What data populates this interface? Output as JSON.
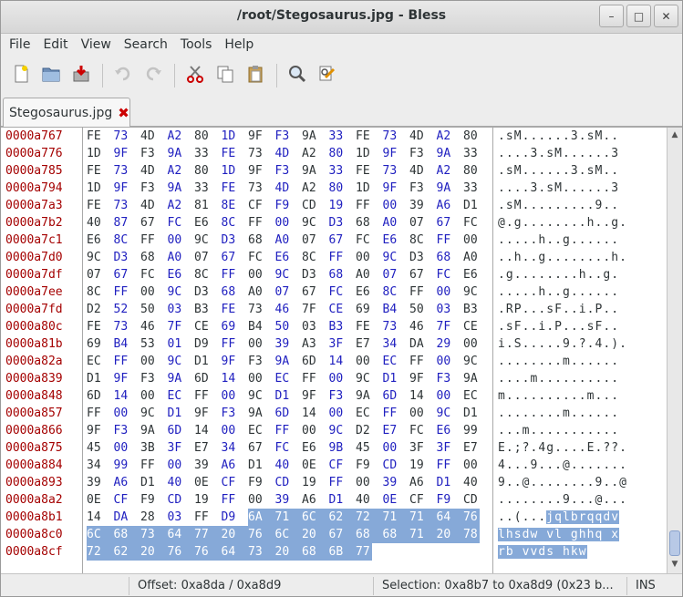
{
  "window": {
    "title": "/root/Stegosaurus.jpg - Bless"
  },
  "window_controls": {
    "minimize": "–",
    "maximize": "□",
    "close": "✕"
  },
  "menu": [
    "File",
    "Edit",
    "View",
    "Search",
    "Tools",
    "Help"
  ],
  "toolbar": [
    {
      "name": "new-file",
      "icon": "new-document-icon"
    },
    {
      "name": "open-file",
      "icon": "folder-open-icon"
    },
    {
      "name": "save-file",
      "icon": "save-icon"
    },
    {
      "sep": true
    },
    {
      "name": "undo",
      "icon": "undo-icon"
    },
    {
      "name": "redo",
      "icon": "redo-icon"
    },
    {
      "sep": true
    },
    {
      "name": "cut",
      "icon": "scissors-icon"
    },
    {
      "name": "copy",
      "icon": "copy-icon"
    },
    {
      "name": "paste",
      "icon": "clipboard-icon"
    },
    {
      "sep": true
    },
    {
      "name": "find",
      "icon": "magnifier-icon"
    },
    {
      "name": "find-replace",
      "icon": "find-replace-icon"
    }
  ],
  "tab": {
    "label": "Stegosaurus.jpg",
    "close": "✖"
  },
  "colors": {
    "offset": "#a40000",
    "byte_alt": "#2020c0",
    "selection": "#86a9d8"
  },
  "hex": {
    "offsets": [
      "0000a767",
      "0000a776",
      "0000a785",
      "0000a794",
      "0000a7a3",
      "0000a7b2",
      "0000a7c1",
      "0000a7d0",
      "0000a7df",
      "0000a7ee",
      "0000a7fd",
      "0000a80c",
      "0000a81b",
      "0000a82a",
      "0000a839",
      "0000a848",
      "0000a857",
      "0000a866",
      "0000a875",
      "0000a884",
      "0000a893",
      "0000a8a2",
      "0000a8b1",
      "0000a8c0",
      "0000a8cf"
    ],
    "rows": [
      "FE 73 4D A2 80 1D 9F F3 9A 33 FE 73 4D A2 80",
      "1D 9F F3 9A 33 FE 73 4D A2 80 1D 9F F3 9A 33",
      "FE 73 4D A2 80 1D 9F F3 9A 33 FE 73 4D A2 80",
      "1D 9F F3 9A 33 FE 73 4D A2 80 1D 9F F3 9A 33",
      "FE 73 4D A2 81 8E CF F9 CD 19 FF 00 39 A6 D1",
      "40 87 67 FC E6 8C FF 00 9C D3 68 A0 07 67 FC",
      "E6 8C FF 00 9C D3 68 A0 07 67 FC E6 8C FF 00",
      "9C D3 68 A0 07 67 FC E6 8C FF 00 9C D3 68 A0",
      "07 67 FC E6 8C FF 00 9C D3 68 A0 07 67 FC E6",
      "8C FF 00 9C D3 68 A0 07 67 FC E6 8C FF 00 9C",
      "D2 52 50 03 B3 FE 73 46 7F CE 69 B4 50 03 B3",
      "FE 73 46 7F CE 69 B4 50 03 B3 FE 73 46 7F CE",
      "69 B4 53 01 D9 FF 00 39 A3 3F E7 34 DA 29 00",
      "EC FF 00 9C D1 9F F3 9A 6D 14 00 EC FF 00 9C",
      "D1 9F F3 9A 6D 14 00 EC FF 00 9C D1 9F F3 9A",
      "6D 14 00 EC FF 00 9C D1 9F F3 9A 6D 14 00 EC",
      "FF 00 9C D1 9F F3 9A 6D 14 00 EC FF 00 9C D1",
      "9F F3 9A 6D 14 00 EC FF 00 9C D2 E7 FC E6 99",
      "45 00 3B 3F E7 34 67 FC E6 9B 45 00 3F 3F E7",
      "34 99 FF 00 39 A6 D1 40 0E CF F9 CD 19 FF 00",
      "39 A6 D1 40 0E CF F9 CD 19 FF 00 39 A6 D1 40",
      "0E CF F9 CD 19 FF 00 39 A6 D1 40 0E CF F9 CD",
      "14 DA 28 03 FF D9 6A 71 6C 62 72 71 71 64 76",
      "6C 68 73 64 77 20 76 6C 20 67 68 68 71 20 78",
      "72 62 20 76 76 64 73 20 68 6B 77"
    ],
    "ascii": [
      ".sM......3.sM..",
      "....3.sM......3",
      ".sM......3.sM..",
      "....3.sM......3",
      ".sM.........9..",
      "@.g........h..g.",
      ".....h..g......",
      "..h..g........h.",
      ".g........h..g.",
      ".....h..g......",
      ".RP...sF..i.P..",
      ".sF..i.P...sF..",
      "i.S.....9.?.4.).",
      "........m......",
      "....m..........",
      "m..........m...",
      "........m......",
      "...m...........",
      "E.;?.4g....E.??.",
      "4...9...@.......",
      "9..@........9..@",
      "........9...@...",
      "..(...jqlbrqqdv",
      "lhsdw vl ghhq x",
      "rb vvds hkw"
    ],
    "selection_start": {
      "row": 22,
      "col": 6
    }
  },
  "status": {
    "offset": "Offset: 0xa8da / 0xa8d9",
    "selection": "Selection: 0xa8b7 to 0xa8d9 (0x23 b...",
    "mode": "INS"
  }
}
